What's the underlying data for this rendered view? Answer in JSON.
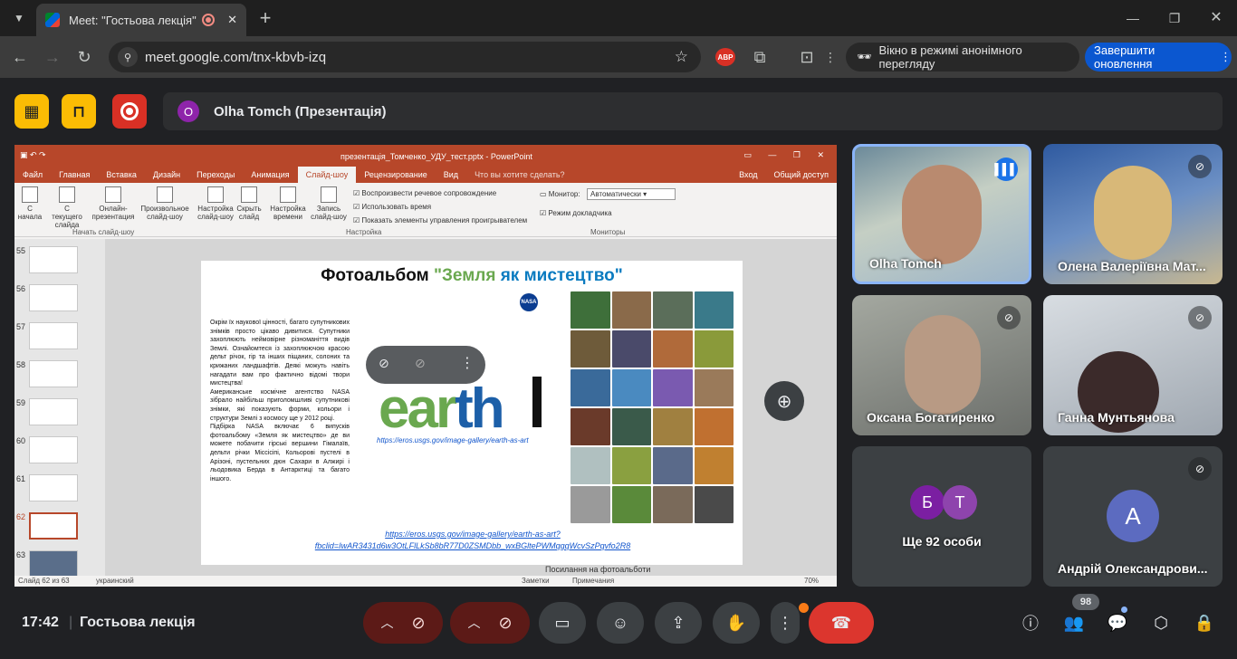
{
  "browser": {
    "tab_title": "Meet: \"Гостьова лекція\"",
    "url": "meet.google.com/tnx-kbvb-izq",
    "abp_label": "ABP",
    "incognito_label": "Вікно в режимі анонімного перегляду",
    "update_label": "Завершити оновлення"
  },
  "meet": {
    "presenter_initial": "O",
    "presenter_label": "Olha Tomch (Презентація)",
    "time": "17:42",
    "meeting_name": "Гостьова лекція",
    "participants_count": "98"
  },
  "powerpoint": {
    "file_title": "презентація_Томченко_УДУ_тест.pptx - PowerPoint",
    "menu": [
      "Файл",
      "Главная",
      "Вставка",
      "Дизайн",
      "Переходы",
      "Анимация",
      "Слайд-шоу",
      "Рецензирование",
      "Вид",
      "Что вы хотите сделать?"
    ],
    "login": "Вход",
    "share": "Общий доступ",
    "ribbon": {
      "from_start": "С начала",
      "from_current": "С текущего слайда",
      "online": "Онлайн-презентация",
      "custom": "Произвольное слайд-шоу",
      "setup": "Настройка слайд-шоу",
      "hide": "Скрыть слайд",
      "timing": "Настройка времени",
      "record": "Запись слайд-шоу",
      "chk1": "Воспроизвести речевое сопровождение",
      "chk2": "Использовать время",
      "chk3": "Показать элементы управления проигрывателем",
      "monitor_label": "Монитор:",
      "monitor_value": "Автоматически",
      "presenter_view": "Режим докладчика",
      "group1": "Начать слайд-шоу",
      "group2": "Настройка",
      "group3": "Мониторы"
    },
    "slide_numbers": [
      "55",
      "56",
      "57",
      "58",
      "59",
      "60",
      "61",
      "62",
      "63"
    ],
    "status_left": "Слайд 62 из 63",
    "status_lang": "украинский",
    "status_notes": "Заметки",
    "status_comments": "Примечания",
    "status_zoom": "70%",
    "notes_text": "Посилання на фотоальботи"
  },
  "slide": {
    "title_part1": "Фотоальбом ",
    "title_part2": "\"Земля ",
    "title_part3": "як мистецтво\"",
    "body1": "Окрім їх наукової цінності, багато супутникових знімків просто цікаво дивитися. Супутники захоплюють неймовірне різноманіття видів Землі. Ознайомтеся із захоплюючою красою дельт річок, гір та інших піщаних, солоних та крижаних ландшафтів. Деякі можуть навіть нагадати вам про фактично відомі твори мистецтва!",
    "body2": "Американське космічне агентство NASA зібрало найбільш приголомшливі супутникові знімки, які показують форми, кольори і структури Землі з космосу ще у 2012 році.",
    "body3": "Підбірка NASA включає 6 випусків фотоальбому «Земля як мистецтво» де ви можете побачити гірські вершини Гімалаїв, дельти річки Міссісіпі, Кольорові пустелі в Арізоні, пустельних дюн Сахари в Алжирі і льодовика Берда в Антарктиці та багато іншого.",
    "logo_part1": "ear",
    "logo_part2": "th",
    "logo_url": "https://eros.usgs.gov/image-gallery/earth-as-art",
    "link": "https://eros.usgs.gov/image-gallery/earth-as-art?fbclid=IwAR3431d6w3OtLFlLkSb8bR77D0ZSMDbb_wxBGltePWMqgqWcvSzPqvfo2R8",
    "nasa": "NASA",
    "grid_colors": [
      "#3e6f3a",
      "#8a6a4a",
      "#5b6e5a",
      "#3a7a8a",
      "#6e5b3a",
      "#4a4a6a",
      "#b06a3a",
      "#8a9a3a",
      "#3a6a9a",
      "#4a8ac0",
      "#7a5ab0",
      "#9a7a5a",
      "#6a3a2a",
      "#3a5a4a",
      "#a08040",
      "#c07030",
      "#b0c0c0",
      "#8aa040",
      "#5a6a8a",
      "#c08030",
      "#9a9a9a",
      "#5a8a3a",
      "#7a6a5a",
      "#4a4a4a"
    ]
  },
  "tiles": [
    {
      "name": "Olha Tomch"
    },
    {
      "name": "Олена Валеріївна Мат..."
    },
    {
      "name": "Оксана Богатиренко"
    },
    {
      "name": "Ганна Мунтьянова"
    },
    {
      "name": "Ще 92 особи",
      "avatar1": "Б",
      "avatar2": "Т"
    },
    {
      "name": "Андрій Олександрови...",
      "avatar": "А"
    }
  ],
  "icons": [
    "tab-search-icon",
    "meet-favicon",
    "record-icon",
    "back-icon",
    "forward-icon",
    "reload-icon",
    "site-info-icon",
    "star-icon",
    "extensions-icon",
    "incognito-icon",
    "mic-off-icon",
    "camera-off-icon",
    "captions-icon",
    "emoji-icon",
    "present-icon",
    "hand-icon",
    "more-icon",
    "end-call-icon",
    "info-icon",
    "people-icon",
    "chat-icon",
    "activities-icon",
    "host-controls-icon"
  ]
}
